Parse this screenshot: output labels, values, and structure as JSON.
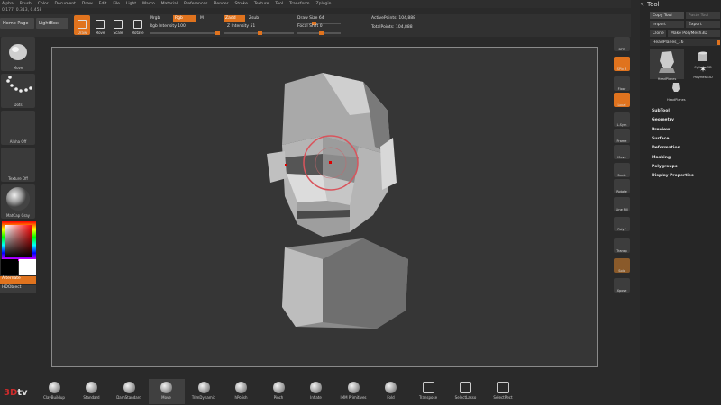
{
  "menu": [
    "Alpha",
    "Brush",
    "Color",
    "Document",
    "Draw",
    "Edit",
    "File",
    "Light",
    "Macro",
    "Material",
    "Preferences",
    "Render",
    "Stroke",
    "Texture",
    "Tool",
    "Transform",
    "Zplugin"
  ],
  "coords": "0.177, 0.313, 0.458",
  "top": {
    "home_page": "Home Page",
    "lightbox": "LightBox",
    "tools": [
      "Draw",
      "Move",
      "Scale",
      "Rotate"
    ],
    "mrgb": "Mrgb",
    "rgb": "Rgb",
    "m": "M",
    "zadd": "Zadd",
    "zsub": "Zsub",
    "rgb_intensity": "Rgb Intensity 100",
    "z_intensity": "Z Intensity 51",
    "draw_size": "Draw Size 64",
    "focal_shift": "Focal Shift 0",
    "active_points": "ActivePoints: 104,888",
    "total_points": "TotalPoints: 104,888"
  },
  "left": {
    "brush_cap": "Move",
    "stroke_cap": "Dots",
    "alpha_cap": "Alpha Off",
    "texture_cap": "Texture Off",
    "material_cap": "MatCap Gray",
    "alternate": "Alternate",
    "hdobject": "HDObject"
  },
  "right_shelf": [
    "BPR",
    "SPix 3",
    "Floor",
    "Local",
    "L.Sym",
    "Frame",
    "Move",
    "Scale",
    "Rotate",
    "Line Fill",
    "PolyF",
    "Transp",
    "Solo",
    "Xpose"
  ],
  "tool_panel": {
    "title": "Tool",
    "copy_tool": "Copy Tool",
    "paste_tool": "Paste Tool",
    "import": "Import",
    "export": "Export",
    "clone": "Clone",
    "make_polymesh": "Make PolyMesh3D",
    "current": "HeadPlanes_16",
    "thumbs": [
      "HeadPlanes",
      "Cylinder3D",
      "PolyMesh3D",
      "HeadPlanes"
    ],
    "sections": [
      "SubTool",
      "Geometry",
      "Preview",
      "Surface",
      "Deformation",
      "Masking",
      "Polygroups",
      "Display Properties"
    ]
  },
  "bottom_brushes": [
    "ClayBuildup",
    "Standard",
    "DamStandard",
    "Move",
    "TrimDynamic",
    "hPolish",
    "Pinch",
    "Inflate",
    "IMM Primitives",
    "Fold",
    "Transpose",
    "SelectLasso",
    "SelectRect"
  ],
  "logo": {
    "a": "3D",
    "b": "tv"
  }
}
